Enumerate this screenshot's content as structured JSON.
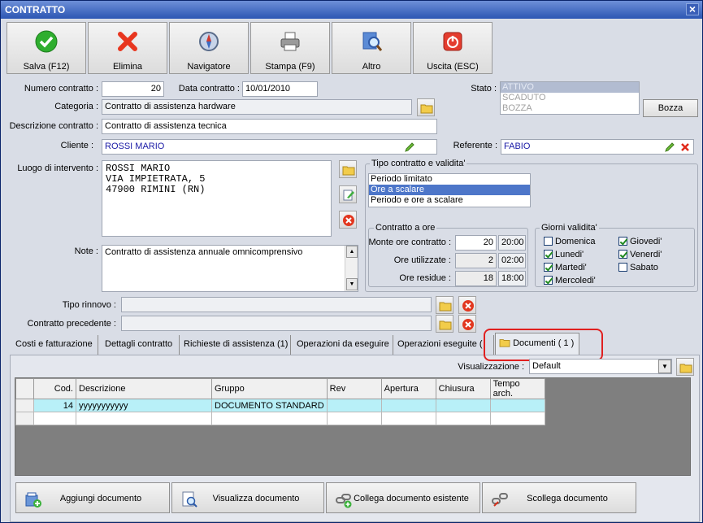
{
  "window": {
    "title": "CONTRATTO",
    "close": "×"
  },
  "toolbar": [
    {
      "label": "Salva (F12)",
      "icon": "checkmark-icon"
    },
    {
      "label": "Elimina",
      "icon": "delete-x-icon"
    },
    {
      "label": "Navigatore",
      "icon": "compass-icon"
    },
    {
      "label": "Stampa (F9)",
      "icon": "printer-icon"
    },
    {
      "label": "Altro",
      "icon": "search-icon"
    },
    {
      "label": "Uscita (ESC)",
      "icon": "power-icon"
    }
  ],
  "form": {
    "numero_label": "Numero contratto :",
    "numero_value": "20",
    "data_label": "Data contratto :",
    "data_value": "10/01/2010",
    "stato_label": "Stato :",
    "stato_options": [
      "ATTIVO",
      "SCADUTO",
      "BOZZA"
    ],
    "stato_button": "Bozza",
    "categoria_label": "Categoria :",
    "categoria_value": "Contratto di assistenza hardware",
    "descrizione_label": "Descrizione contratto :",
    "descrizione_value": "Contratto di assistenza tecnica",
    "cliente_label": "Cliente :",
    "cliente_value": "ROSSI MARIO",
    "referente_label": "Referente :",
    "referente_value": "FABIO",
    "luogo_label": "Luogo di intervento :",
    "luogo_value": "ROSSI MARIO\nVIA IMPIETRATA, 5\n47900 RIMINI (RN)",
    "note_label": "Note :",
    "note_value": "Contratto di assistenza annuale omnicomprensivo",
    "tipo_rinnovo_label": "Tipo rinnovo :",
    "tipo_rinnovo_value": "",
    "contratto_precedente_label": "Contratto precedente :",
    "contratto_precedente_value": ""
  },
  "tipo_contratto": {
    "title": "Tipo contratto e validita'",
    "options": [
      "Periodo limitato",
      "Ore a scalare",
      "Periodo e ore a scalare"
    ],
    "selected_index": 1
  },
  "contratto_ore": {
    "title": "Contratto a ore",
    "monte_label": "Monte ore contratto :",
    "monte_value": "20",
    "monte_time": "20:00",
    "utilizzate_label": "Ore utilizzate :",
    "utilizzate_value": "2",
    "utilizzate_time": "02:00",
    "residue_label": "Ore residue :",
    "residue_value": "18",
    "residue_time": "18:00"
  },
  "giorni": {
    "title": "Giorni validita'",
    "days": [
      {
        "label": "Domenica",
        "checked": false
      },
      {
        "label": "Lunedi'",
        "checked": true
      },
      {
        "label": "Martedi'",
        "checked": true
      },
      {
        "label": "Mercoledi'",
        "checked": true
      },
      {
        "label": "Giovedi'",
        "checked": true
      },
      {
        "label": "Venerdi'",
        "checked": true
      },
      {
        "label": "Sabato",
        "checked": false
      }
    ]
  },
  "tabs": [
    "Costi e fatturazione",
    "Dettagli contratto",
    "Richieste di assistenza (1)",
    "Operazioni da eseguire",
    "Operazioni eseguite (",
    "Documenti ( 1 )"
  ],
  "active_tab": 5,
  "documenti": {
    "visualizzazione_label": "Visualizzazione :",
    "visualizzazione_value": "Default",
    "columns": [
      "",
      "Cod.",
      "Descrizione",
      "Gruppo",
      "Rev",
      "Apertura",
      "Chiusura",
      "Tempo arch."
    ],
    "rows": [
      [
        "",
        "14",
        "yyyyyyyyyyy",
        "DOCUMENTO STANDARD",
        "",
        "",
        "",
        ""
      ],
      [
        "",
        "",
        "",
        "",
        "",
        "",
        "",
        ""
      ]
    ],
    "buttons": [
      {
        "label": "Aggiungi documento",
        "icon": "add-document-icon"
      },
      {
        "label": "Visualizza documento",
        "icon": "view-document-icon"
      },
      {
        "label": "Collega documento esistente",
        "icon": "link-document-icon"
      },
      {
        "label": "Scollega documento",
        "icon": "unlink-document-icon"
      }
    ]
  },
  "colors": {
    "titlebar": "#2b56b3",
    "selection": "#4d76c9",
    "row_highlight": "#b8f0f8",
    "callout": "#e02020",
    "client_text": "#1a1aa6"
  }
}
